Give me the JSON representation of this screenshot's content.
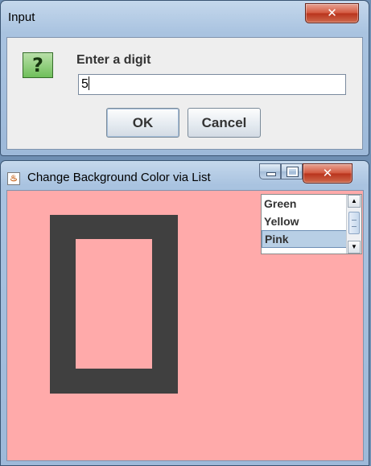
{
  "dialog": {
    "title": "Input",
    "close_glyph": "✕",
    "icon": "question-icon",
    "icon_glyph": "?",
    "prompt": "Enter a digit",
    "input_value": "5",
    "ok_label": "OK",
    "cancel_label": "Cancel"
  },
  "frame": {
    "title": "Change Background Color via List",
    "close_glyph": "✕",
    "icon": "java-icon",
    "icon_glyph": "♨",
    "background_color": "#ffaaaa",
    "digit_color": "#404040",
    "list": {
      "items": [
        "Green",
        "Yellow",
        "Pink"
      ],
      "selected": "Pink"
    }
  }
}
